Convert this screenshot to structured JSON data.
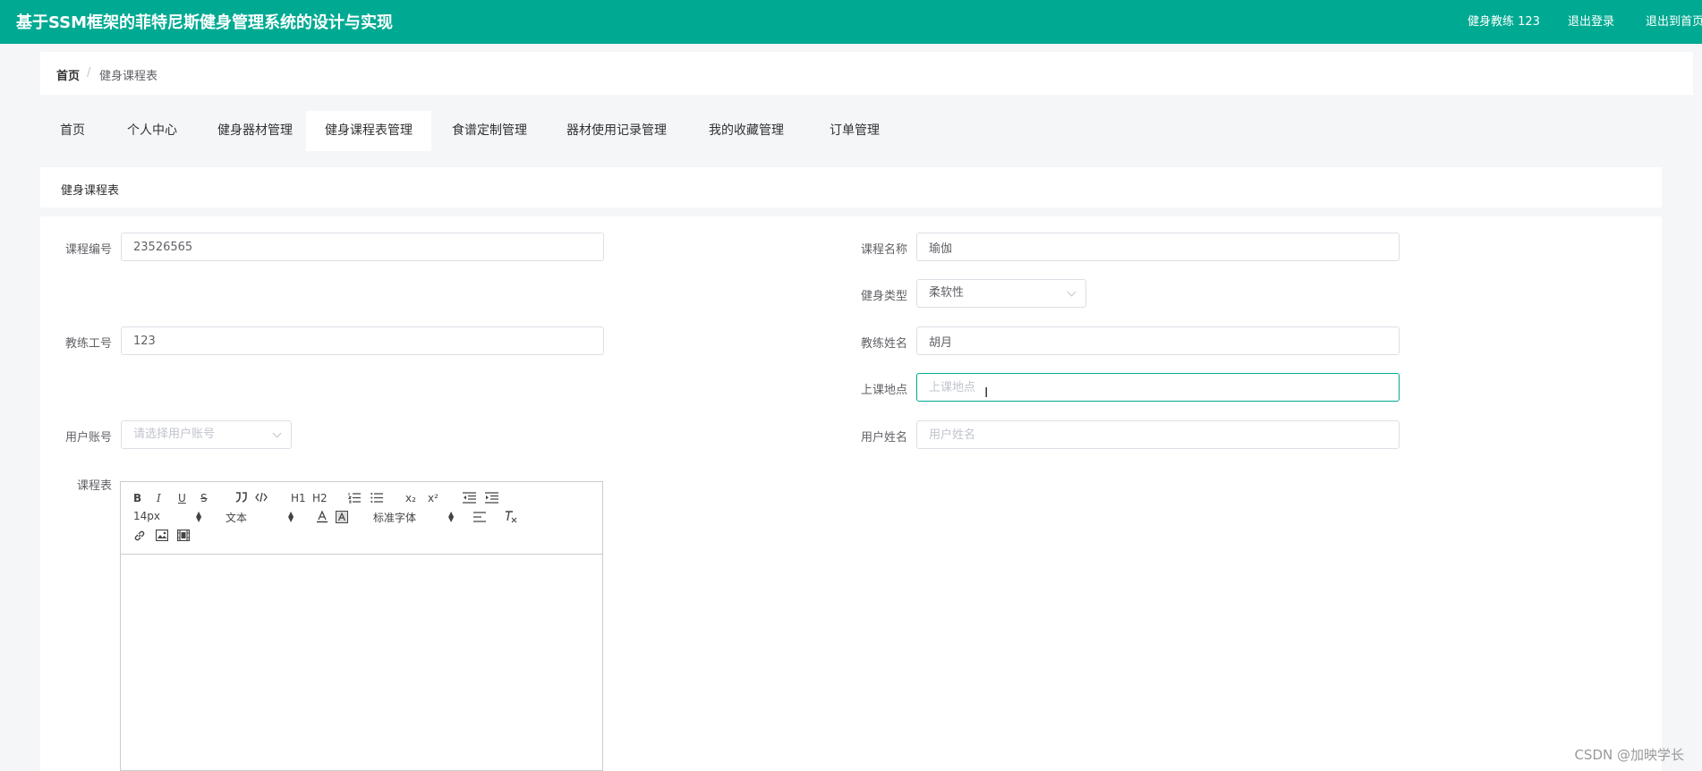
{
  "header": {
    "title": "基于SSM框架的菲特尼斯健身管理系统的设计与实现",
    "user_label": "健身教练 123",
    "logout": "退出登录",
    "exit_home": "退出到首页"
  },
  "breadcrumb": {
    "home": "首页",
    "separator": "/",
    "current": "健身课程表"
  },
  "tabs": [
    {
      "label": "首页"
    },
    {
      "label": "个人中心"
    },
    {
      "label": "健身器材管理"
    },
    {
      "label": "健身课程表管理",
      "active": true
    },
    {
      "label": "食谱定制管理"
    },
    {
      "label": "器材使用记录管理"
    },
    {
      "label": "我的收藏管理"
    },
    {
      "label": "订单管理"
    }
  ],
  "section": {
    "title": "健身课程表"
  },
  "form": {
    "course_no": {
      "label": "课程编号",
      "value": "23526565"
    },
    "course_name": {
      "label": "课程名称",
      "value": "瑜伽"
    },
    "fitness_type": {
      "label": "健身类型",
      "value": "柔软性"
    },
    "coach_id": {
      "label": "教练工号",
      "value": "123"
    },
    "coach_name": {
      "label": "教练姓名",
      "value": "胡月"
    },
    "location": {
      "label": "上课地点",
      "placeholder": "上课地点"
    },
    "user_account": {
      "label": "用户账号",
      "placeholder": "请选择用户账号"
    },
    "user_name": {
      "label": "用户姓名",
      "placeholder": "用户姓名"
    },
    "schedule": {
      "label": "课程表"
    }
  },
  "editor_toolbar": {
    "font_size": "14px",
    "block_format": "文本",
    "font_family": "标准字体",
    "h1": "H1",
    "h2": "H2",
    "bold": "B",
    "italic": "I",
    "underline": "U",
    "strike": "S",
    "sub": "x₂",
    "sup": "x²"
  },
  "colors": {
    "accent": "#00aa92",
    "page_bg": "#f5f6f8"
  },
  "watermark": "CSDN @加映学长"
}
